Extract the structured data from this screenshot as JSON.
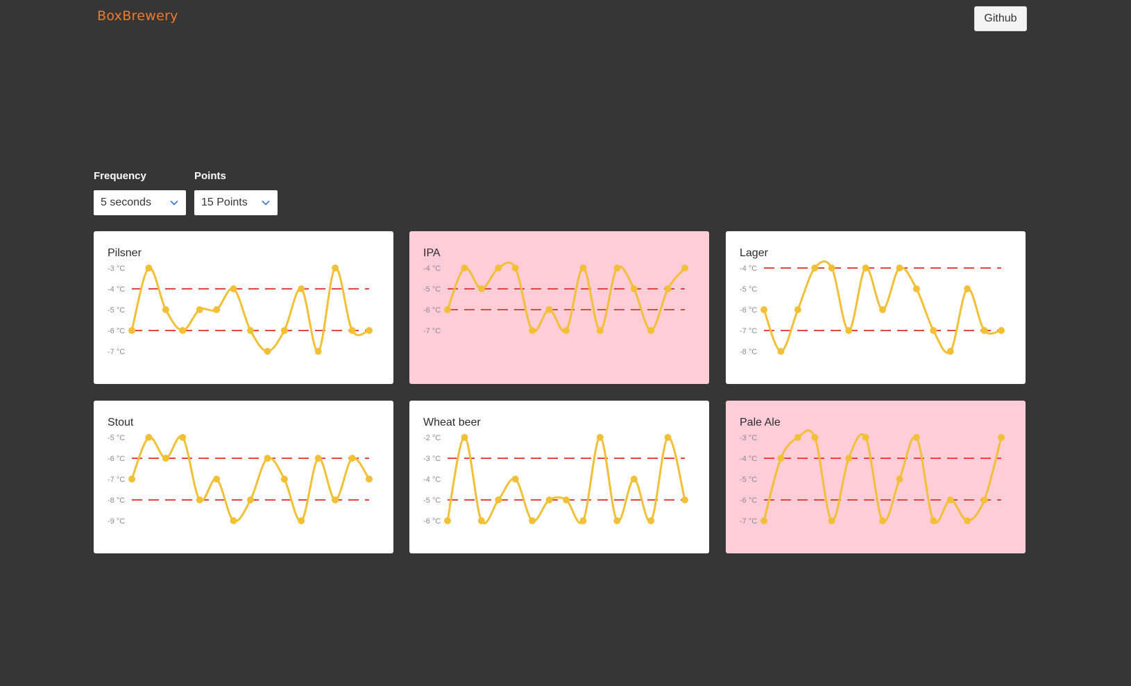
{
  "header": {
    "brand": "BoxBrewery",
    "github_label": "Github"
  },
  "controls": {
    "frequency": {
      "label": "Frequency",
      "value": "5 seconds"
    },
    "points": {
      "label": "Points",
      "value": "15 Points"
    }
  },
  "colors": {
    "background": "#363636",
    "brand": "#f07b2a",
    "line": "#f2c037",
    "threshold": "#e8453c",
    "card_ok": "#ffffff",
    "card_alert": "#ffcdd8"
  },
  "chart_data": [
    {
      "type": "line",
      "title": "Pilsner",
      "status": "ok",
      "unit": "°C",
      "ylim": [
        -7,
        -3
      ],
      "yticks": [
        "-3 °C",
        "-4 °C",
        "-5 °C",
        "-6 °C",
        "-7 °C"
      ],
      "thresholds": [
        -4,
        -6
      ],
      "values": [
        -6,
        -3,
        -5,
        -6,
        -5,
        -5,
        -4,
        -6,
        -7,
        -6,
        -4,
        -7,
        -3,
        -6,
        -6
      ]
    },
    {
      "type": "line",
      "title": "IPA",
      "status": "alert",
      "unit": "°C",
      "ylim": [
        -7,
        -4
      ],
      "yticks": [
        "-4 °C",
        "-5 °C",
        "-6 °C",
        "-7 °C"
      ],
      "thresholds": [
        -5,
        -6
      ],
      "values": [
        -6,
        -4,
        -5,
        -4,
        -4,
        -7,
        -6,
        -7,
        -4,
        -7,
        -4,
        -5,
        -7,
        -5,
        -4
      ]
    },
    {
      "type": "line",
      "title": "Lager",
      "status": "ok",
      "unit": "°C",
      "ylim": [
        -8,
        -4
      ],
      "yticks": [
        "-4 °C",
        "-5 °C",
        "-6 °C",
        "-7 °C",
        "-8 °C"
      ],
      "thresholds": [
        -4,
        -7
      ],
      "values": [
        -6,
        -8,
        -6,
        -4,
        -4,
        -7,
        -4,
        -6,
        -4,
        -5,
        -7,
        -8,
        -5,
        -7,
        -7
      ]
    },
    {
      "type": "line",
      "title": "Stout",
      "status": "ok",
      "unit": "°C",
      "ylim": [
        -9,
        -5
      ],
      "yticks": [
        "-5 °C",
        "-6 °C",
        "-7 °C",
        "-8 °C",
        "-9 °C"
      ],
      "thresholds": [
        -6,
        -8
      ],
      "values": [
        -7,
        -5,
        -6,
        -5,
        -8,
        -7,
        -9,
        -8,
        -6,
        -7,
        -9,
        -6,
        -8,
        -6,
        -7
      ]
    },
    {
      "type": "line",
      "title": "Wheat beer",
      "status": "ok",
      "unit": "°C",
      "ylim": [
        -6,
        -2
      ],
      "yticks": [
        "-2 °C",
        "-3 °C",
        "-4 °C",
        "-5 °C",
        "-6 °C"
      ],
      "thresholds": [
        -3,
        -5
      ],
      "values": [
        -6,
        -2,
        -6,
        -5,
        -4,
        -6,
        -5,
        -5,
        -6,
        -2,
        -6,
        -4,
        -6,
        -2,
        -5
      ]
    },
    {
      "type": "line",
      "title": "Pale Ale",
      "status": "alert",
      "unit": "°C",
      "ylim": [
        -7,
        -3
      ],
      "yticks": [
        "-3 °C",
        "-4 °C",
        "-5 °C",
        "-6 °C",
        "-7 °C"
      ],
      "thresholds": [
        -4,
        -6
      ],
      "values": [
        -7,
        -4,
        -3,
        -3,
        -7,
        -4,
        -3,
        -7,
        -5,
        -3,
        -7,
        -6,
        -7,
        -6,
        -3
      ]
    }
  ]
}
